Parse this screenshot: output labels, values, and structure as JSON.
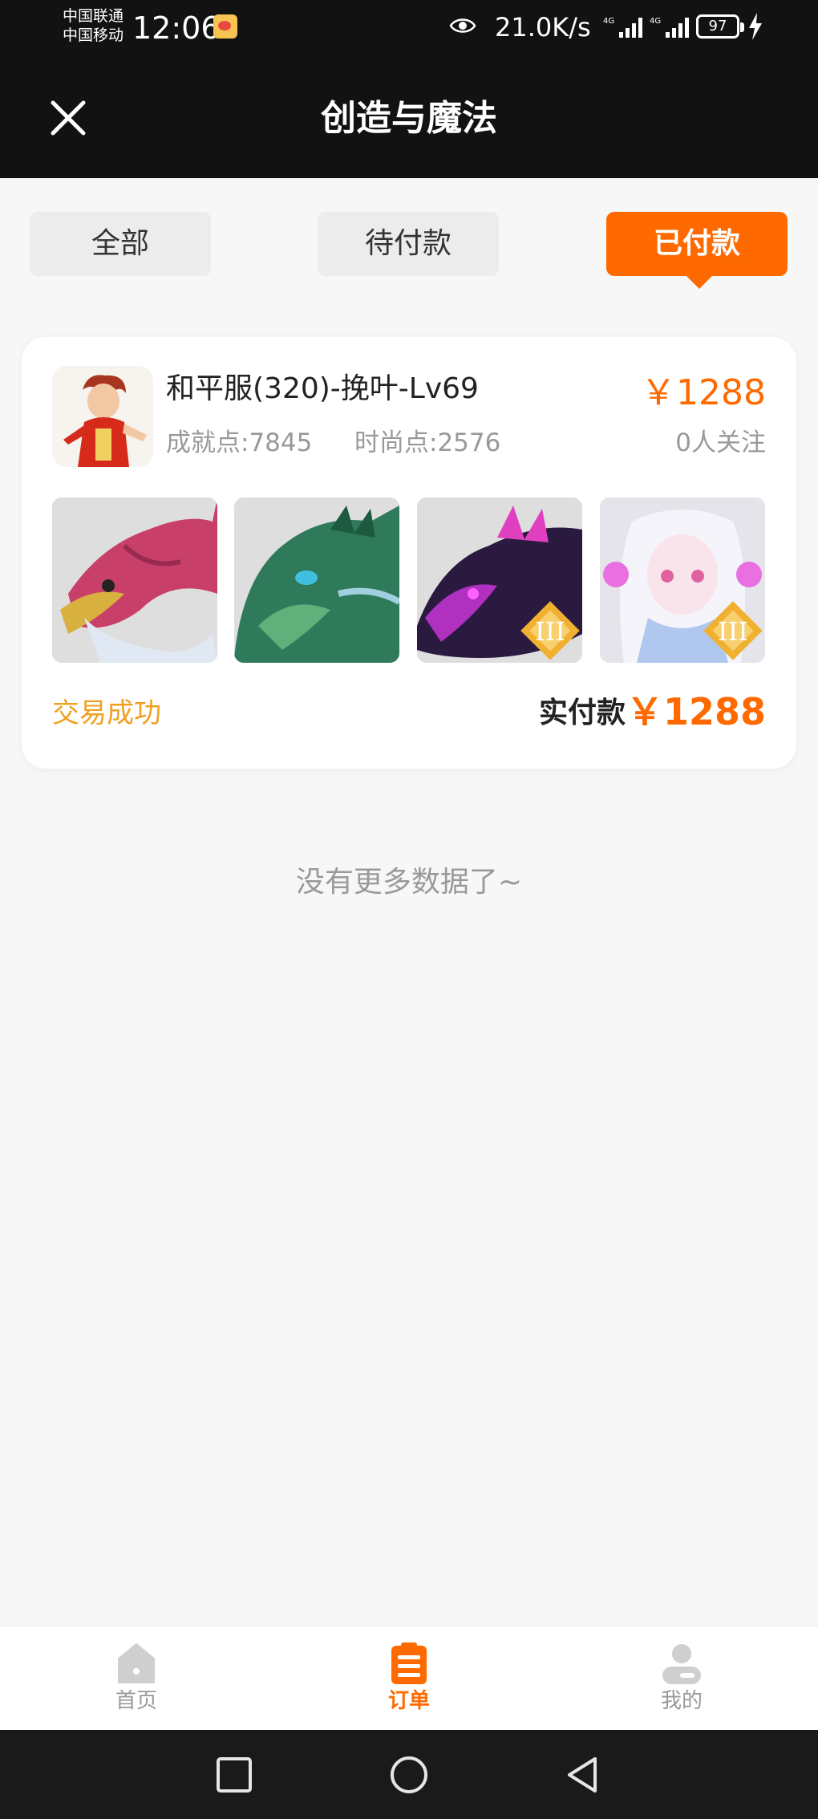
{
  "status_bar": {
    "carrier1": "中国联通",
    "carrier2": "中国移动",
    "time": "12:06",
    "net_speed": "21.0K/s",
    "signal1_label": "4G",
    "signal2_label": "4G",
    "battery": "97",
    "icons": [
      "weibo-icon",
      "eye-icon",
      "signal-icon",
      "signal-icon",
      "battery-icon",
      "charging-icon"
    ]
  },
  "header": {
    "title": "创造与魔法",
    "close_icon": "close-icon"
  },
  "tabs": [
    {
      "label": "全部",
      "active": false
    },
    {
      "label": "待付款",
      "active": false
    },
    {
      "label": "已付款",
      "active": true
    }
  ],
  "order": {
    "character_name": "和平服(320)-挽叶-Lv69",
    "achievement": "成就点:7845",
    "fashion": "时尚点:2576",
    "price": "￥1288",
    "followers": "0人关注",
    "pets": [
      {
        "name": "pink-gold-dragon",
        "badge": ""
      },
      {
        "name": "green-dragon",
        "badge": ""
      },
      {
        "name": "purple-dragon",
        "badge": "III"
      },
      {
        "name": "white-spirit",
        "badge": "III"
      }
    ],
    "status": "交易成功",
    "paid_label": "实付款",
    "paid_amount": "￥1288"
  },
  "no_more_text": "没有更多数据了~",
  "bottom_nav": [
    {
      "label": "首页",
      "icon": "home-icon",
      "active": false
    },
    {
      "label": "订单",
      "icon": "orders-icon",
      "active": true
    },
    {
      "label": "我的",
      "icon": "profile-icon",
      "active": false
    }
  ],
  "colors": {
    "accent": "#ff6a00",
    "status_success": "#f0a020",
    "header_bg": "#121212",
    "page_bg": "#f7f7f7"
  }
}
